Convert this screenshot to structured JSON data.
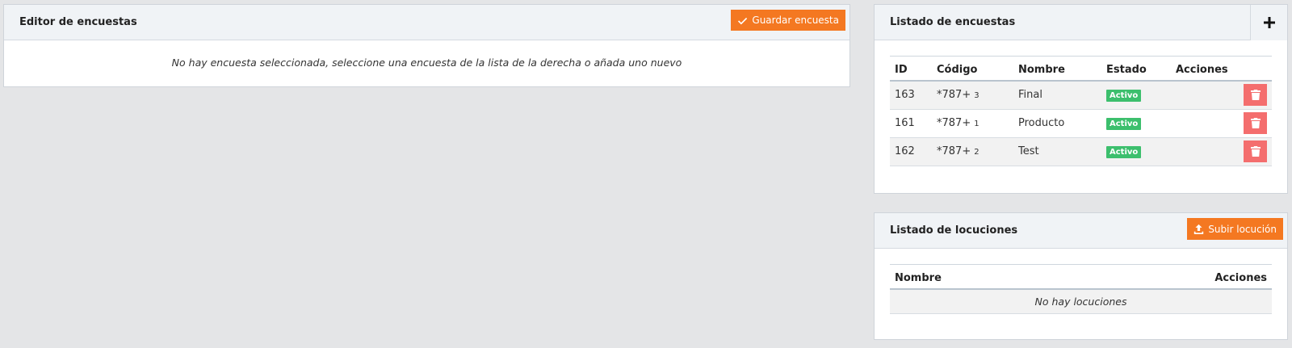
{
  "editor": {
    "title": "Editor de encuestas",
    "save_label": "Guardar encuesta",
    "empty_message": "No hay encuesta seleccionada, seleccione una encuesta de la lista de la derecha o añada uno nuevo"
  },
  "surveys": {
    "title": "Listado de encuestas",
    "columns": [
      "ID",
      "Código",
      "Nombre",
      "Estado",
      "Acciones"
    ],
    "rows": [
      {
        "id": "163",
        "code": "*787+",
        "code_suffix": "3",
        "name": "Final",
        "status": "Activo"
      },
      {
        "id": "161",
        "code": "*787+",
        "code_suffix": "1",
        "name": "Producto",
        "status": "Activo"
      },
      {
        "id": "162",
        "code": "*787+",
        "code_suffix": "2",
        "name": "Test",
        "status": "Activo"
      }
    ]
  },
  "locutions": {
    "title": "Listado de locuciones",
    "upload_label": "Subir locución",
    "columns": [
      "Nombre",
      "Acciones"
    ],
    "empty_message": "No hay locuciones"
  },
  "colors": {
    "accent": "#f47821",
    "active_badge": "#3cbf6d",
    "delete": "#f46e6e"
  }
}
